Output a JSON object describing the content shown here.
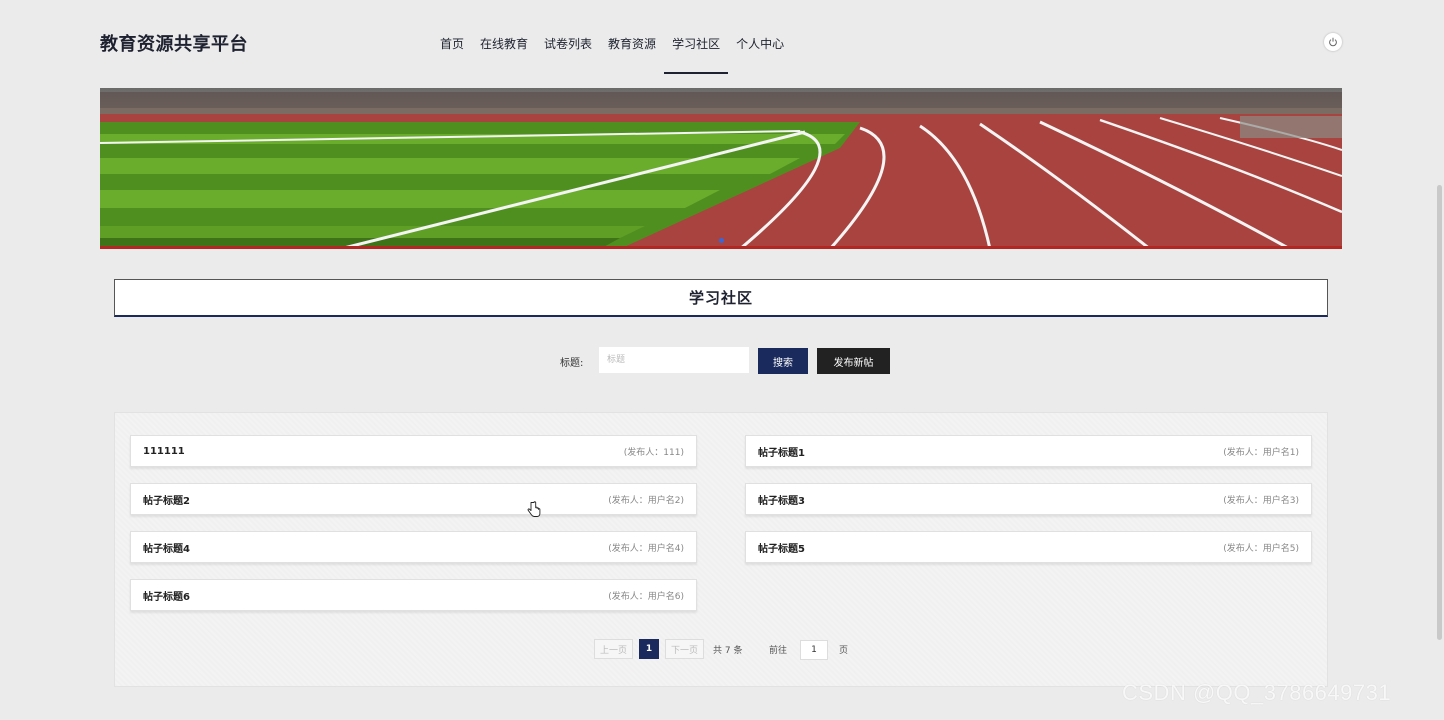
{
  "header": {
    "logo": "教育资源共享平台",
    "nav": [
      "首页",
      "在线教育",
      "试卷列表",
      "教育资源",
      "学习社区",
      "个人中心"
    ],
    "active_nav": "学习社区"
  },
  "section": {
    "title": "学习社区"
  },
  "search": {
    "label": "标题:",
    "placeholder": "标题",
    "search_button": "搜索",
    "publish_button": "发布新帖"
  },
  "posts": [
    {
      "title": "111111",
      "author": "(发布人：111)"
    },
    {
      "title": "帖子标题1",
      "author": "(发布人：用户名1)"
    },
    {
      "title": "帖子标题2",
      "author": "(发布人：用户名2)"
    },
    {
      "title": "帖子标题3",
      "author": "(发布人：用户名3)"
    },
    {
      "title": "帖子标题4",
      "author": "(发布人：用户名4)"
    },
    {
      "title": "帖子标题5",
      "author": "(发布人：用户名5)"
    },
    {
      "title": "帖子标题6",
      "author": "(发布人：用户名6)"
    }
  ],
  "pagination": {
    "prev": "上一页",
    "current": "1",
    "next": "下一页",
    "total": "共 7 条",
    "goto_label": "前往",
    "goto_value": "1",
    "page_unit": "页"
  },
  "watermark": "CSDN @QQ_3786649731",
  "colors": {
    "primary": "#1a2a5c",
    "dark_button": "#222222",
    "background": "#ebebeb"
  },
  "icons": {
    "power": "power-icon",
    "cursor": "hand-cursor-icon"
  }
}
